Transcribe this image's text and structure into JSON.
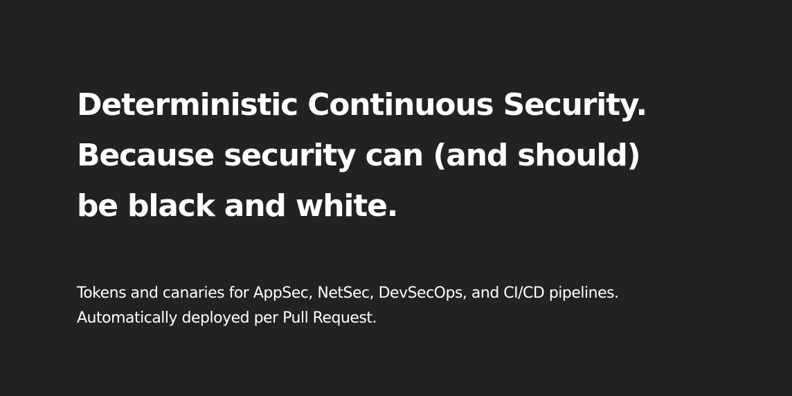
{
  "colors": {
    "background": "#222222",
    "text": "#ffffff"
  },
  "hero": {
    "headline_lines": [
      "Deterministic Continuous Security.",
      "Because security can (and should)",
      "be black and white."
    ],
    "subline_lines": [
      "Tokens and canaries for AppSec, NetSec, DevSecOps, and CI/CD pipelines.",
      "Automatically deployed per Pull Request."
    ]
  }
}
